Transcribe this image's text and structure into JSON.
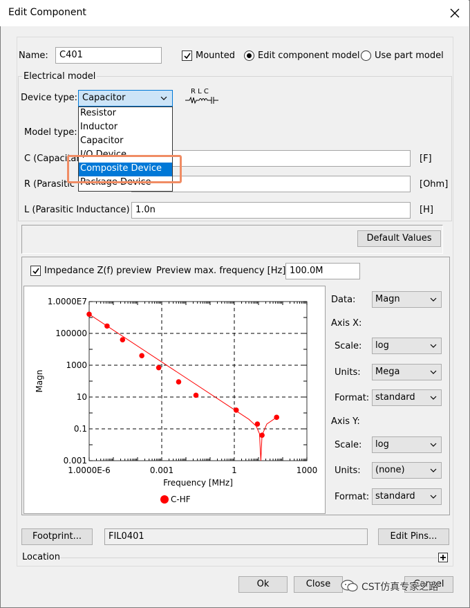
{
  "window": {
    "title": "Edit Component"
  },
  "name": {
    "label": "Name:",
    "value": "C401"
  },
  "mounted": {
    "label": "Mounted",
    "checked": true
  },
  "mode": {
    "edit_label": "Edit component model",
    "part_label": "Use part model",
    "selected": "edit"
  },
  "electrical": {
    "group_label": "Electrical model",
    "device_type_label": "Device type:",
    "device_type_value": "Capacitor",
    "symbol_text": "R  L  C",
    "model_type_label": "Model type:",
    "dropdown_items": [
      "Resistor",
      "Inductor",
      "Capacitor",
      "I/O Device",
      "Composite Device",
      "Package Device"
    ],
    "dropdown_selected_index": 4,
    "c_label": "C (Capacitance)",
    "c_unit": "[F]",
    "r_label": "R (Parasitic Resistance)",
    "r_unit": "[Ohm]",
    "l_label": "L (Parasitic Inductance)",
    "l_value": "1.0n",
    "l_unit": "[H]",
    "default_values_label": "Default Values"
  },
  "preview": {
    "checkbox_label": "Impedance Z(f) preview",
    "checked": true,
    "max_freq_label": "Preview max. frequency [Hz]:",
    "max_freq_value": "100.0M",
    "side": {
      "data_label": "Data:",
      "data_value": "Magn",
      "axis_x_label": "Axis X:",
      "x_scale_label": "Scale:",
      "x_scale_value": "log",
      "x_units_label": "Units:",
      "x_units_value": "Mega",
      "x_format_label": "Format:",
      "x_format_value": "standard",
      "axis_y_label": "Axis Y:",
      "y_scale_label": "Scale:",
      "y_scale_value": "log",
      "y_units_label": "Units:",
      "y_units_value": "(none)",
      "y_format_label": "Format:",
      "y_format_value": "standard"
    }
  },
  "chart_data": {
    "type": "line",
    "xlabel": "Frequency [MHz]",
    "ylabel": "Magn",
    "xscale": "log",
    "yscale": "log",
    "xlim": [
      1e-06,
      1000
    ],
    "ylim": [
      0.001,
      10000000
    ],
    "xticks": [
      "1.0000E-6",
      "0.001",
      "1",
      "1000"
    ],
    "yticks": [
      "1.0000E7",
      "100000",
      "1000",
      "10",
      "0.1",
      "0.001"
    ],
    "grid": true,
    "legend": "bottom-center",
    "series": [
      {
        "name": "C-HF",
        "color": "#ff0000",
        "markers": [
          {
            "x": 1e-06,
            "y": 1600000
          },
          {
            "x": 5.5e-06,
            "y": 290000
          },
          {
            "x": 2.4e-05,
            "y": 40000
          },
          {
            "x": 0.00015,
            "y": 4000
          },
          {
            "x": 0.00075,
            "y": 700
          },
          {
            "x": 0.005,
            "y": 90
          },
          {
            "x": 0.026,
            "y": 13
          },
          {
            "x": 1.2,
            "y": 1.5
          },
          {
            "x": 9,
            "y": 0.2
          },
          {
            "x": 14,
            "y": 0.04
          },
          {
            "x": 56,
            "y": 0.53
          }
        ],
        "curve": [
          {
            "x": 1e-06,
            "y": 1600000
          },
          {
            "x": 0.001,
            "y": 1600
          },
          {
            "x": 1,
            "y": 1.6
          },
          {
            "x": 4,
            "y": 0.4
          },
          {
            "x": 8,
            "y": 0.15
          },
          {
            "x": 11,
            "y": 0.05
          },
          {
            "x": 12.5,
            "y": 0.001
          },
          {
            "x": 14,
            "y": 0.04
          },
          {
            "x": 22,
            "y": 0.2
          },
          {
            "x": 56,
            "y": 0.53
          }
        ]
      }
    ]
  },
  "footprint": {
    "button_label": "Footprint...",
    "value": "FIL0401",
    "edit_pins_label": "Edit Pins..."
  },
  "location": {
    "label": "Location"
  },
  "buttons": {
    "ok": "Ok",
    "close": "Close",
    "cancel": "Cancel"
  },
  "watermark": {
    "text": "CST仿真专家之路"
  }
}
